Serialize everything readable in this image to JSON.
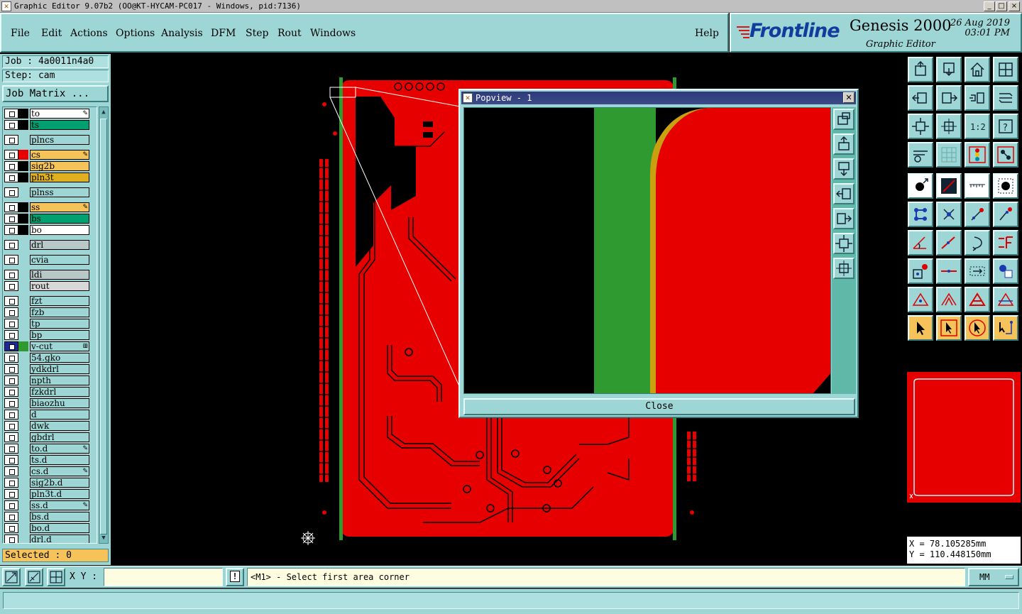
{
  "window": {
    "title": "Graphic Editor 9.07b2 (OO@KT-HYCAM-PC017 - Windows, pid:7136)",
    "controls": [
      "_",
      "□",
      "×"
    ]
  },
  "menu": {
    "items": [
      "File",
      "Edit",
      "Actions",
      "Options",
      "Analysis",
      "DFM",
      "Step",
      "Rout",
      "Windows"
    ],
    "help": "Help"
  },
  "brand": {
    "logo": "Frontline",
    "product": "Genesis 2000",
    "date": "26 Aug 2019",
    "time": "03:01 PM",
    "subtitle": "Graphic Editor"
  },
  "job": {
    "job_line": "Job : 4a0011n4a0",
    "step_line": "Step: cam",
    "matrix_button": "Job Matrix ..."
  },
  "layers": [
    {
      "name": "to",
      "color": "#ffffff",
      "swatch": "#000000",
      "mark": "✎"
    },
    {
      "name": "ts",
      "color": "#00a070",
      "swatch": "#000000",
      "mark": ""
    },
    {
      "name": "plncs",
      "color": "#9ed6d6",
      "swatch": "",
      "mark": ""
    },
    {
      "name": "cs",
      "color": "#f5c35a",
      "swatch": "#e60000",
      "mark": "✎"
    },
    {
      "name": "sig2b",
      "color": "#f5c35a",
      "swatch": "#000000",
      "mark": ""
    },
    {
      "name": "pln3t",
      "color": "#e0b020",
      "swatch": "#000000",
      "mark": ""
    },
    {
      "name": "plnss",
      "color": "#9ed6d6",
      "swatch": "",
      "mark": ""
    },
    {
      "name": "ss",
      "color": "#f5c35a",
      "swatch": "#000000",
      "mark": "✎"
    },
    {
      "name": "bs",
      "color": "#00a070",
      "swatch": "#000000",
      "mark": ""
    },
    {
      "name": "bo",
      "color": "#ffffff",
      "swatch": "#000000",
      "mark": ""
    },
    {
      "name": "drl",
      "color": "#b8c8c8",
      "swatch": "",
      "mark": ""
    },
    {
      "name": "cvia",
      "color": "#9ed6d6",
      "swatch": "",
      "mark": ""
    },
    {
      "name": "ldi",
      "color": "#b8c8c8",
      "swatch": "",
      "mark": ""
    },
    {
      "name": "rout",
      "color": "#d8d8d8",
      "swatch": "",
      "mark": ""
    },
    {
      "name": "fzt",
      "color": "#9ed6d6",
      "swatch": "",
      "mark": ""
    },
    {
      "name": "fzb",
      "color": "#9ed6d6",
      "swatch": "",
      "mark": ""
    },
    {
      "name": "tp",
      "color": "#9ed6d6",
      "swatch": "",
      "mark": ""
    },
    {
      "name": "bp",
      "color": "#9ed6d6",
      "swatch": "",
      "mark": ""
    },
    {
      "name": "v-cut",
      "color": "#9ed6d6",
      "swatch": "#2f9a2f",
      "mark": "⊞",
      "active": true
    },
    {
      "name": "54.gko",
      "color": "#9ed6d6",
      "swatch": "",
      "mark": ""
    },
    {
      "name": "ydkdrl",
      "color": "#9ed6d6",
      "swatch": "",
      "mark": ""
    },
    {
      "name": "npth",
      "color": "#9ed6d6",
      "swatch": "",
      "mark": ""
    },
    {
      "name": "fzkdrl",
      "color": "#9ed6d6",
      "swatch": "",
      "mark": ""
    },
    {
      "name": "biaozhu",
      "color": "#9ed6d6",
      "swatch": "",
      "mark": ""
    },
    {
      "name": "d",
      "color": "#9ed6d6",
      "swatch": "",
      "mark": ""
    },
    {
      "name": "dwk",
      "color": "#9ed6d6",
      "swatch": "",
      "mark": ""
    },
    {
      "name": "gbdrl",
      "color": "#9ed6d6",
      "swatch": "",
      "mark": ""
    },
    {
      "name": "to.d",
      "color": "#9ed6d6",
      "swatch": "",
      "mark": "✎"
    },
    {
      "name": "ts.d",
      "color": "#9ed6d6",
      "swatch": "",
      "mark": ""
    },
    {
      "name": "cs.d",
      "color": "#9ed6d6",
      "swatch": "",
      "mark": "✎"
    },
    {
      "name": "sig2b.d",
      "color": "#9ed6d6",
      "swatch": "",
      "mark": ""
    },
    {
      "name": "pln3t.d",
      "color": "#9ed6d6",
      "swatch": "",
      "mark": ""
    },
    {
      "name": "ss.d",
      "color": "#9ed6d6",
      "swatch": "",
      "mark": "✎"
    },
    {
      "name": "bs.d",
      "color": "#9ed6d6",
      "swatch": "",
      "mark": ""
    },
    {
      "name": "bo.d",
      "color": "#9ed6d6",
      "swatch": "",
      "mark": ""
    },
    {
      "name": "drl.d",
      "color": "#9ed6d6",
      "swatch": "",
      "mark": ""
    }
  ],
  "selected": "Selected : 0",
  "popview": {
    "title": "Popview - 1",
    "close_label": "Close"
  },
  "coords": {
    "x": "X = 78.105285mm",
    "y": "Y = 110.448150mm"
  },
  "command": {
    "xy_label": "X Y :",
    "xy_value": "",
    "message": "<M1> - Select first area corner",
    "units": "MM"
  },
  "colors": {
    "panel": "#9ed6d6",
    "board": "#e60000",
    "vcut": "#2f9a2f",
    "popview_title": "#2e3a7a"
  }
}
